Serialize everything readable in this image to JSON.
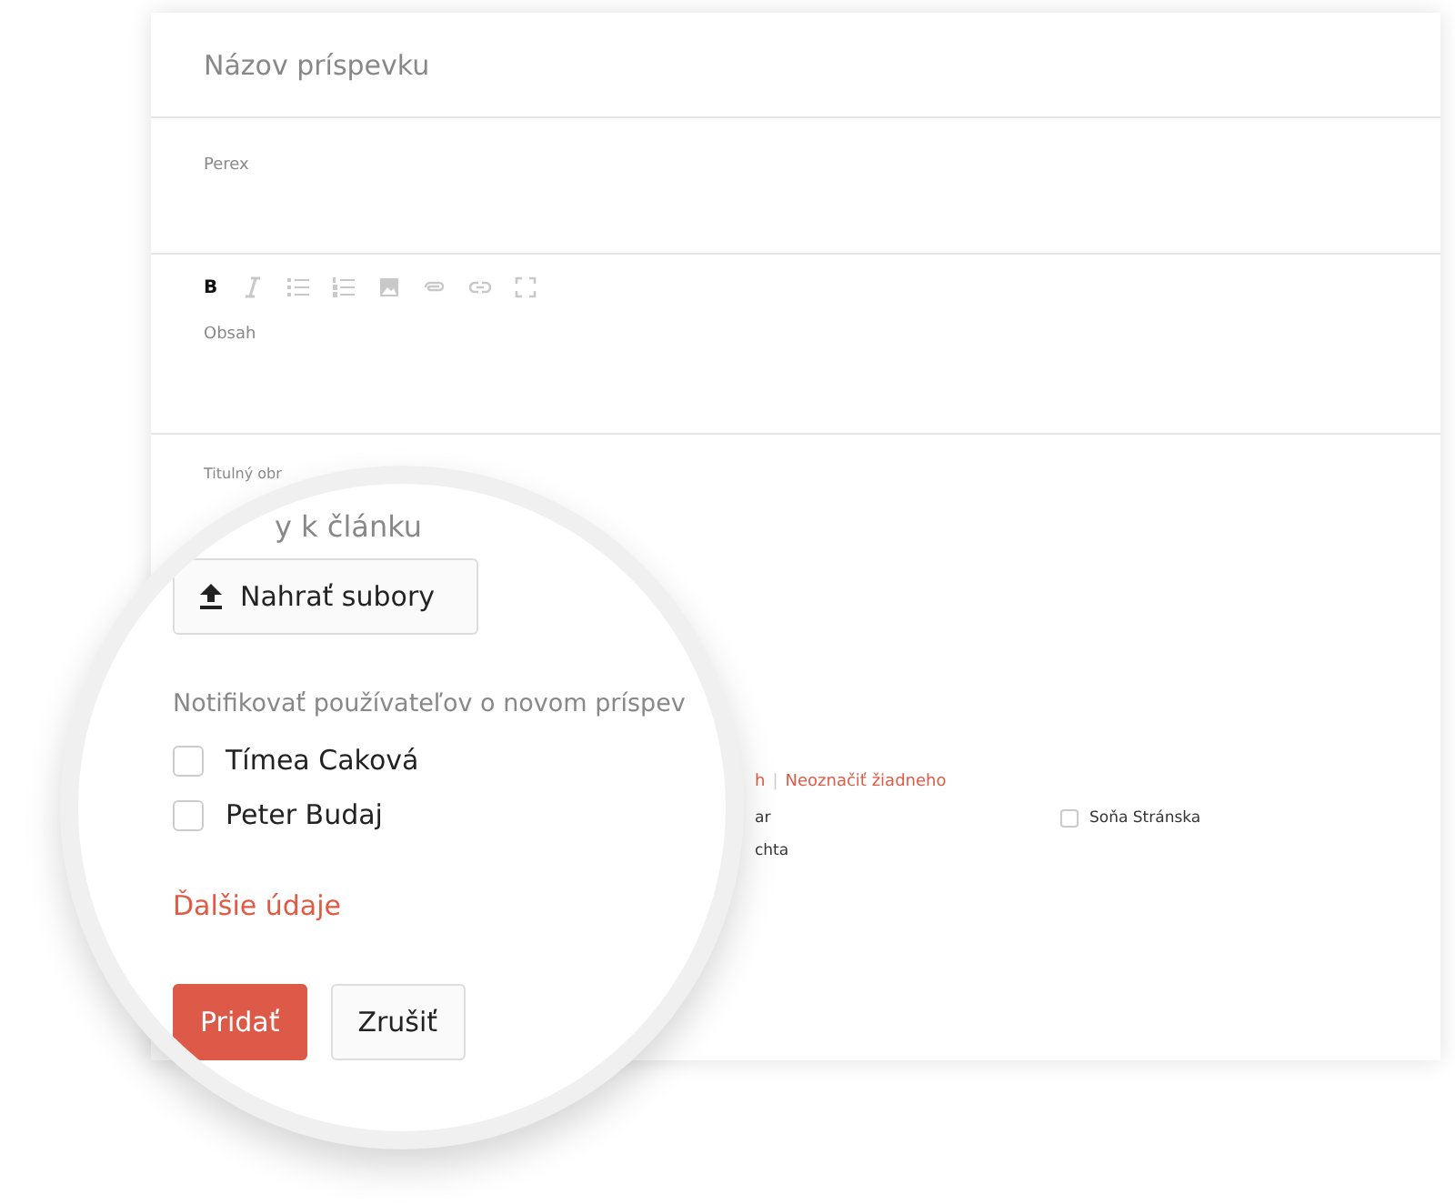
{
  "title_field": {
    "placeholder": "Názov príspevku"
  },
  "perex_field": {
    "placeholder": "Perex"
  },
  "editor": {
    "toolbar": [
      {
        "kind": "bold",
        "label": "B",
        "disabled": false
      },
      {
        "kind": "italic",
        "disabled": true
      },
      {
        "kind": "bullets",
        "disabled": true
      },
      {
        "kind": "numbers",
        "disabled": true
      },
      {
        "kind": "image",
        "disabled": true
      },
      {
        "kind": "attach",
        "disabled": true
      },
      {
        "kind": "link",
        "disabled": true
      },
      {
        "kind": "fullscreen",
        "disabled": true
      }
    ],
    "placeholder": "Obsah"
  },
  "cover_label": "Titulný obr",
  "select_links": {
    "cut": "h",
    "separator": "|",
    "none": "Neoznačiť žiadneho"
  },
  "users_behind": [
    {
      "kind": "text",
      "label": "ar"
    },
    {
      "kind": "checkbox",
      "label": "Soňa Stránska",
      "checked": false
    },
    {
      "kind": "text",
      "label": "chta"
    }
  ],
  "magnifier": {
    "attachments_label": "y k článku",
    "upload_button": "Nahrať subory",
    "notify_label": "Notifikovať používateľov o novom príspev",
    "users": [
      {
        "name": "Tímea Caková",
        "checked": false
      },
      {
        "name": "Peter Budaj",
        "checked": false
      }
    ],
    "more_link": "Ďalšie údaje",
    "buttons": [
      {
        "label": "Pridať",
        "kind": "primary"
      },
      {
        "label": "Zrušiť",
        "kind": "secondary"
      }
    ]
  }
}
